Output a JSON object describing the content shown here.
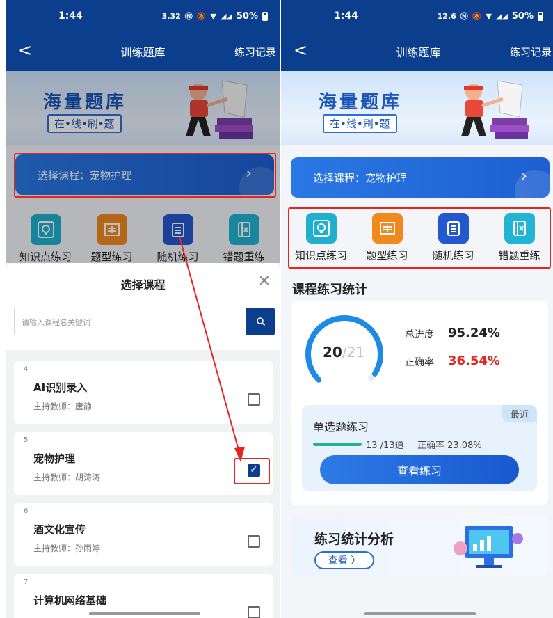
{
  "status": {
    "left_time": "1:44",
    "left_speed": "3.32",
    "right_time": "1:44",
    "right_speed": "12.6",
    "battery": "50%"
  },
  "nav": {
    "title": "训练题库",
    "right_link": "练习记录",
    "back_icon": "chevron-left-icon"
  },
  "banner": {
    "headline": "海量题库",
    "tagline": "在•线•刷•题"
  },
  "course_selector": {
    "label": "选择课程：宠物护理"
  },
  "practice_modes": [
    {
      "label": "知识点练习",
      "icon": "lightbulb-icon",
      "color": "#1fb0cf"
    },
    {
      "label": "题型练习",
      "icon": "form-icon",
      "color": "#f18a1e"
    },
    {
      "label": "随机练习",
      "icon": "checklist-icon",
      "color": "#2358cf"
    },
    {
      "label": "错题重练",
      "icon": "wrong-book-icon",
      "color": "#23b3d3"
    }
  ],
  "course_sheet": {
    "title": "选择课程",
    "search_placeholder": "请输入课程名关键词",
    "courses": [
      {
        "index": "4",
        "name": "AI识别录入",
        "teacher": "主持教师：唐静",
        "selected": false
      },
      {
        "index": "5",
        "name": "宠物护理",
        "teacher": "主持教师：胡涛涛",
        "selected": true
      },
      {
        "index": "6",
        "name": "酒文化宣传",
        "teacher": "主持教师：孙雨婷",
        "selected": false
      },
      {
        "index": "7",
        "name": "计算机网络基础",
        "teacher": "",
        "selected": false
      }
    ]
  },
  "stats": {
    "section_title": "课程练习统计",
    "done": "20",
    "total": "/21",
    "progress_label": "总进度",
    "progress_value": "95.24%",
    "progress_fraction": 0.9524,
    "accuracy_label": "正确率",
    "accuracy_value": "36.54%",
    "recent_tag": "最近",
    "recent_title": "单选题练习",
    "recent_progress": "13 /13道",
    "recent_accuracy": "正确率 23.08%",
    "review_button": "查看练习"
  },
  "analysis": {
    "title": "练习统计分析",
    "button": "查看 〉"
  },
  "colors": {
    "primary": "#0b3f8e",
    "accent_blue": "#1d5fd1",
    "accuracy_red": "#e52620",
    "highlight_red": "#e52620"
  }
}
